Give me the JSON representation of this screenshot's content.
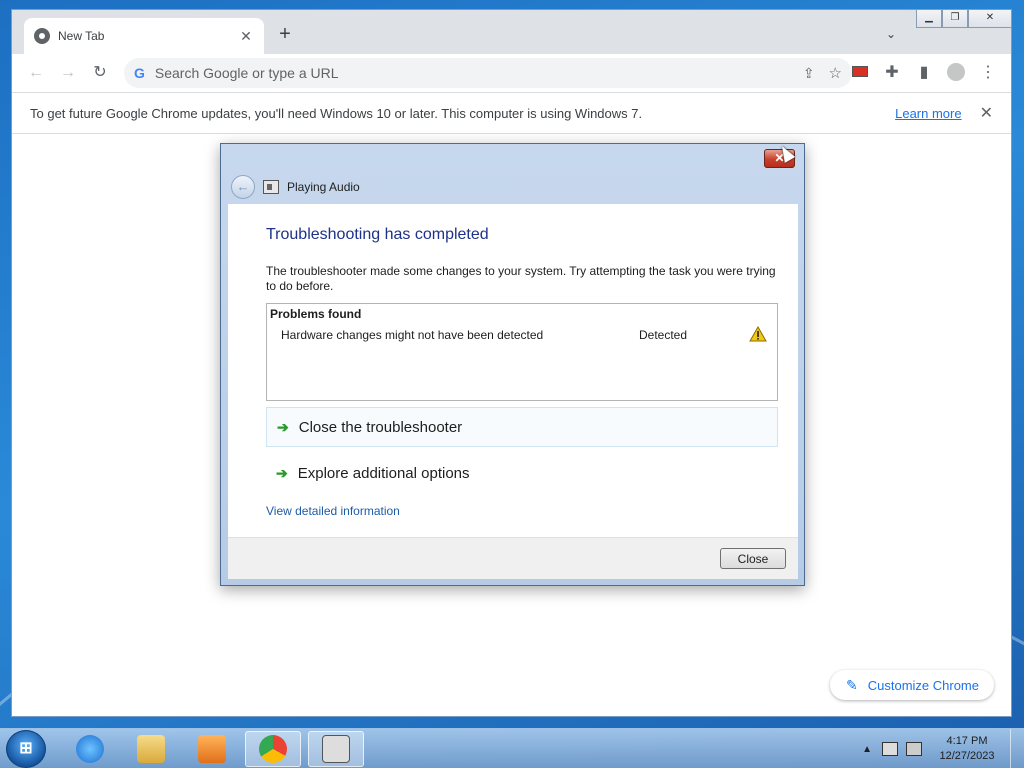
{
  "browser": {
    "tab_title": "New Tab",
    "tab_close": "✕",
    "new_tab": "+",
    "omnibox_placeholder": "Search Google or type a URL",
    "google_g": "G"
  },
  "infobar": {
    "message": "To get future Google Chrome updates, you'll need Windows 10 or later. This computer is using Windows 7.",
    "link": "Learn more",
    "close": "✕"
  },
  "customize": {
    "label": "Customize Chrome"
  },
  "dialog": {
    "header_title": "Playing Audio",
    "heading": "Troubleshooting has completed",
    "description": "The troubleshooter made some changes to your system. Try attempting the task you were trying to do before.",
    "problems_header": "Problems found",
    "problem": {
      "name": "Hardware changes might not have been detected",
      "status": "Detected"
    },
    "commands": [
      "Close the troubleshooter",
      "Explore additional options"
    ],
    "detail_link": "View detailed information",
    "close_button": "Close"
  },
  "taskbar": {
    "start": "⊞",
    "clock_time": "4:17 PM",
    "clock_date": "12/27/2023"
  },
  "colors": {
    "accent": "#1a73e8",
    "dialog_heading": "#1e3287",
    "link": "#1e5ba8",
    "arrow": "#2a9a2a"
  }
}
